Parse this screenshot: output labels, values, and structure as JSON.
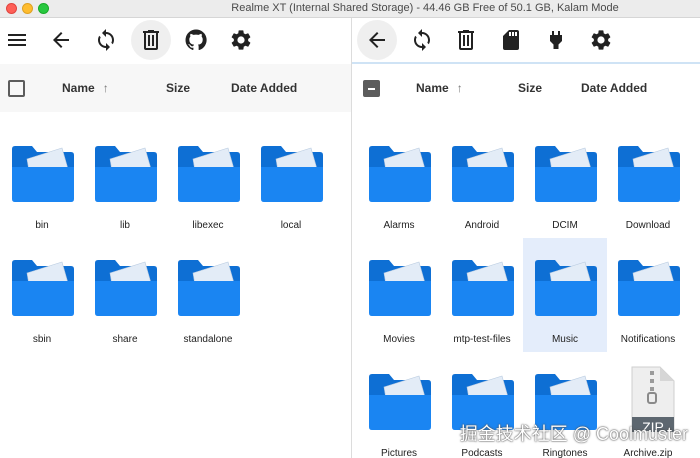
{
  "window": {
    "title": "Realme XT (Internal Shared Storage) - 44.46 GB Free of 50.1 GB, Kalam Mode"
  },
  "colors": {
    "folder_blue": "#1a85f2",
    "folder_back": "#0e6fd4",
    "paper": "#e3ecf7",
    "selected_bg": "#e4edfb",
    "zip_gray": "#5d6770"
  },
  "left_toolbar": {
    "icons": [
      "menu-icon",
      "back-arrow-icon",
      "refresh-icon",
      "delete-icon",
      "github-icon",
      "gear-icon"
    ]
  },
  "right_toolbar": {
    "icons": [
      "back-arrow-icon",
      "refresh-icon",
      "delete-icon",
      "sd-card-icon",
      "plug-icon",
      "gear-icon"
    ]
  },
  "left_header": {
    "name": "Name",
    "sort": "↑",
    "size": "Size",
    "date": "Date Added"
  },
  "right_header": {
    "name": "Name",
    "sort": "↑",
    "size": "Size",
    "date": "Date Added"
  },
  "left_items": [
    {
      "name": "bin",
      "type": "folder"
    },
    {
      "name": "lib",
      "type": "folder"
    },
    {
      "name": "libexec",
      "type": "folder"
    },
    {
      "name": "local",
      "type": "folder"
    },
    {
      "name": "sbin",
      "type": "folder"
    },
    {
      "name": "share",
      "type": "folder"
    },
    {
      "name": "standalone",
      "type": "folder"
    }
  ],
  "right_items": [
    {
      "name": "Alarms",
      "type": "folder"
    },
    {
      "name": "Android",
      "type": "folder"
    },
    {
      "name": "DCIM",
      "type": "folder"
    },
    {
      "name": "Download",
      "type": "folder"
    },
    {
      "name": "Movies",
      "type": "folder"
    },
    {
      "name": "mtp-test-files",
      "type": "folder"
    },
    {
      "name": "Music",
      "type": "folder",
      "selected": true
    },
    {
      "name": "Notifications",
      "type": "folder"
    },
    {
      "name": "Pictures",
      "type": "folder"
    },
    {
      "name": "Podcasts",
      "type": "folder"
    },
    {
      "name": "Ringtones",
      "type": "folder"
    },
    {
      "name": "Archive.zip",
      "type": "zip",
      "badge": "ZIP"
    }
  ],
  "watermark": "掘金技术社区 @ Coolmuster"
}
